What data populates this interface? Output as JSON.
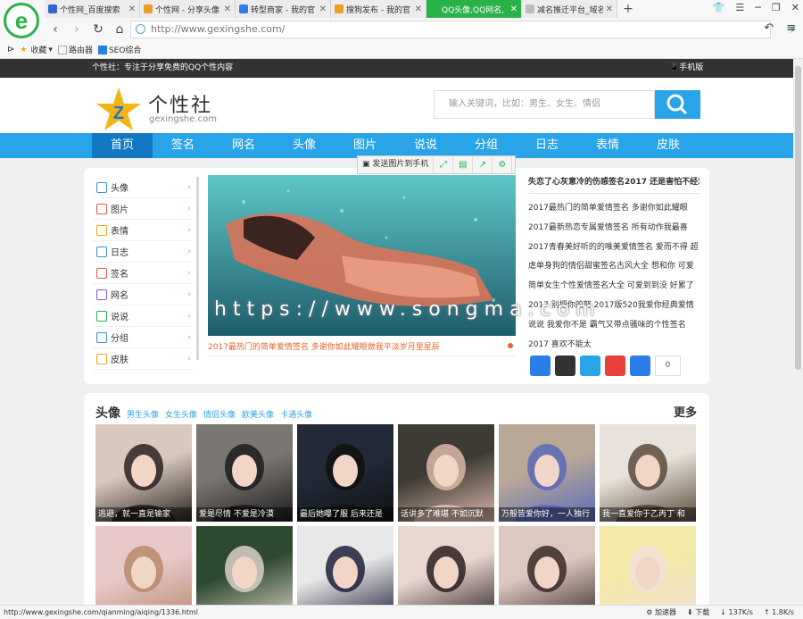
{
  "browser": {
    "tabs": [
      {
        "label": "个性网_百度搜索",
        "icon_color": "#3366cc",
        "active": false
      },
      {
        "label": "个性网 - 分享头像",
        "icon_color": "#e8a02a",
        "active": false
      },
      {
        "label": "转型商家 - 我的官",
        "icon_color": "#2a7ee8",
        "active": false
      },
      {
        "label": "搜狗发布 - 我的官",
        "icon_color": "#e8a02a",
        "active": false
      },
      {
        "label": "QQ头像,QQ网名,",
        "icon_color": "#2ab24a",
        "active": true
      },
      {
        "label": "减名推迁平台_域名",
        "icon_color": "#bbbbbb",
        "active": false
      }
    ],
    "url": "http://www.gexingshe.com/",
    "favorites": [
      "收藏",
      "路由器",
      "SEO综合"
    ]
  },
  "site": {
    "slogan": "个性社：专注于分享免费的QQ个性内容",
    "mobile": "手机版",
    "brand": "个性社",
    "domain": "gexingshe.com",
    "search_placeholder": "输入关键词，比如：男生、女生、情侣",
    "nav": [
      "首页",
      "签名",
      "网名",
      "头像",
      "图片",
      "说说",
      "分组",
      "日志",
      "表情",
      "皮肤"
    ],
    "send_to_phone": "发送图片到手机",
    "left_menu": [
      {
        "label": "头像",
        "color": "#3a8ee6"
      },
      {
        "label": "图片",
        "color": "#e85a4a"
      },
      {
        "label": "表情",
        "color": "#f0a81a"
      },
      {
        "label": "日志",
        "color": "#3a8ee6"
      },
      {
        "label": "签名",
        "color": "#e85a4a"
      },
      {
        "label": "网名",
        "color": "#8a5ad8"
      },
      {
        "label": "说说",
        "color": "#2ab24a"
      },
      {
        "label": "分组",
        "color": "#3a8ee6"
      },
      {
        "label": "皮肤",
        "color": "#f0a81a"
      }
    ],
    "slide_caption": "2017最热门的简单爱情签名 多谢你如此耀眼做我平淡岁月里星辰",
    "watermark": "https://www.songma.com",
    "article_title": "失恋了心灰意冷的伤感签名2017 还是害怕不经意间",
    "article_text": "2017最热门的简单爱情签名 多谢你如此耀眼 2017最新热恋专属爱情签名 所有动作我最喜 2017青春美好听的的唯美爱情签名 爱而不得 超虐单身狗的情侣甜蜜签名古风大全 想和你 可爱简单女生个性爱情签名大全 可爱到到没 好累了2017 别把你的努 2017版520我爱你经典爱情说说 我爱你不是 霸气又带点骚味的个性签名2017 喜欢不能太",
    "share_count": "0",
    "avatars_title": "头像",
    "avatars_links": [
      "男生头像",
      "女生头像",
      "情侣头像",
      "欧美头像",
      "卡通头像"
    ],
    "more": "更多",
    "thumbs": [
      "逃避，就一直是输家",
      "爱是尽情 不爱是冷漠",
      "最后她曝了服 后来还是",
      "话讲多了难堪 不如沉默",
      "万般皆爱你好，一人独行",
      "我一直爱你于乙丙丁 和",
      "",
      "",
      "",
      "",
      "",
      ""
    ]
  },
  "status": {
    "url": "http://www.gexingshe.com/qianming/aiqing/1336.html",
    "speed_tag": "加速器",
    "download": "下载",
    "down": "137K/s",
    "up": "1.8K/s"
  }
}
